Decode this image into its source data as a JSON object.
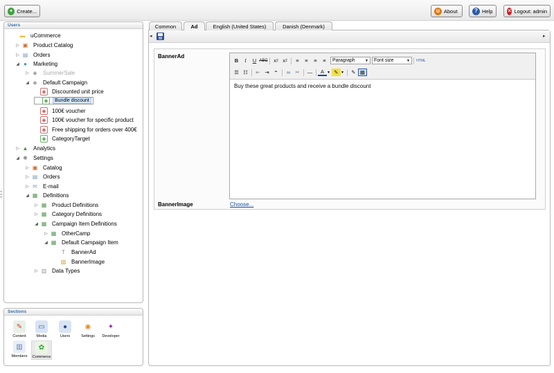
{
  "topbar": {
    "create_label": "Create...",
    "about_label": "About",
    "help_label": "Help",
    "logout_label": "Logout: admin"
  },
  "users_panel": {
    "title": "Users",
    "tree": [
      {
        "label": "uCommerce",
        "icon": "folder-icon"
      },
      {
        "label": "Product Catalog",
        "icon": "catalog-icon"
      },
      {
        "label": "Orders",
        "icon": "orders-icon"
      },
      {
        "label": "Marketing",
        "icon": "marketing-icon"
      },
      {
        "label": "SummerSale",
        "icon": "campaign-icon"
      },
      {
        "label": "Default Campaign",
        "icon": "campaign-icon"
      },
      {
        "label": "Discounted unit price",
        "icon": "tag-icon"
      },
      {
        "label": "Bundle discount",
        "icon": "tag-icon"
      },
      {
        "label": "100€ voucher",
        "icon": "tag-icon"
      },
      {
        "label": "100€ voucher for specific product",
        "icon": "tag-icon"
      },
      {
        "label": "Free shipping for orders over 400€",
        "icon": "tag-icon"
      },
      {
        "label": "CategoryTarget",
        "icon": "tag-icon"
      },
      {
        "label": "Analytics",
        "icon": "analytics-icon"
      },
      {
        "label": "Settings",
        "icon": "settings-icon"
      },
      {
        "label": "Catalog",
        "icon": "catalog-icon"
      },
      {
        "label": "Orders",
        "icon": "orders-icon"
      },
      {
        "label": "E-mail",
        "icon": "email-icon"
      },
      {
        "label": "Definitions",
        "icon": "definitions-icon"
      },
      {
        "label": "Product Definitions",
        "icon": "definitions-icon"
      },
      {
        "label": "Category Definitions",
        "icon": "definitions-icon"
      },
      {
        "label": "Campaign Item Definitions",
        "icon": "definitions-icon"
      },
      {
        "label": "OtherCamp",
        "icon": "definitions-icon"
      },
      {
        "label": "Default Campaign Item",
        "icon": "definitions-icon"
      },
      {
        "label": "BannerAd",
        "icon": "text-field-icon"
      },
      {
        "label": "BannerImage",
        "icon": "image-field-icon"
      },
      {
        "label": "Data Types",
        "icon": "datatypes-icon"
      }
    ]
  },
  "sections_panel": {
    "title": "Sections",
    "items": [
      {
        "label": "Content",
        "icon": "content-icon"
      },
      {
        "label": "Media",
        "icon": "media-icon"
      },
      {
        "label": "Users",
        "icon": "users-icon"
      },
      {
        "label": "Settings",
        "icon": "settings-icon"
      },
      {
        "label": "Developer",
        "icon": "developer-icon"
      },
      {
        "label": "Members",
        "icon": "members-icon"
      },
      {
        "label": "Commerce",
        "icon": "commerce-icon"
      }
    ]
  },
  "editor": {
    "tabs": [
      {
        "label": "Common"
      },
      {
        "label": "Ad"
      },
      {
        "label": "English (United States)"
      },
      {
        "label": "Danish (Denmark)"
      }
    ],
    "active_tab": "Ad",
    "banner_ad_label": "BannerAd",
    "banner_image_label": "BannerImage",
    "choose_link": "Choose...",
    "format_select": "Paragraph",
    "font_size_select": "Font size",
    "html_button": "HTML",
    "content_text": "Buy these great products and receive a bundle discount"
  },
  "colors": {
    "accent": "#3a6fa8",
    "selected_bg": "#d6e7fb",
    "link": "#1a4fa0"
  }
}
